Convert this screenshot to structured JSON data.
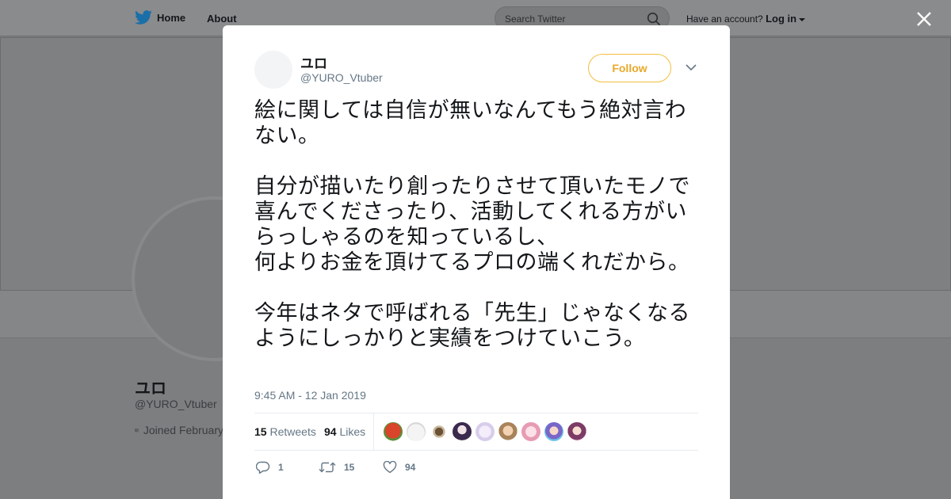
{
  "topbar": {
    "home_label": "Home",
    "about_label": "About",
    "search_placeholder": "Search Twitter",
    "account_prompt": "Have an account?",
    "login_label": "Log in"
  },
  "background_profile": {
    "name": "ユロ",
    "handle": "@YURO_Vtuber",
    "joined": "Joined February"
  },
  "tweet": {
    "author_name": "ユロ",
    "author_handle": "@YURO_Vtuber",
    "follow_label": "Follow",
    "text": "絵に関しては自信が無いなんてもう絶対言わない。\n\n自分が描いたり創ったりさせて頂いたモノで喜んでくださったり、活動してくれる方がいらっしゃるのを知っているし、\n何よりお金を頂けてるプロの端くれだから。\n\n今年はネタで呼ばれる「先生」じゃなくなるようにしっかりと実績をつけていこう。",
    "timestamp": "9:45 AM - 12 Jan 2019",
    "retweets_count": "15",
    "retweets_label": "Retweets",
    "likes_count": "94",
    "likes_label": "Likes",
    "reply_count": "1",
    "retweet_action_count": "15",
    "like_action_count": "94"
  },
  "colors": {
    "follow_accent": "#f3be3f",
    "twitter_blue": "#1da1f2",
    "muted": "#657786"
  },
  "icons": [
    "twitter-bird-icon",
    "search-icon",
    "close-icon",
    "chevron-down-icon",
    "calendar-icon",
    "reply-icon",
    "retweet-icon",
    "heart-icon"
  ]
}
